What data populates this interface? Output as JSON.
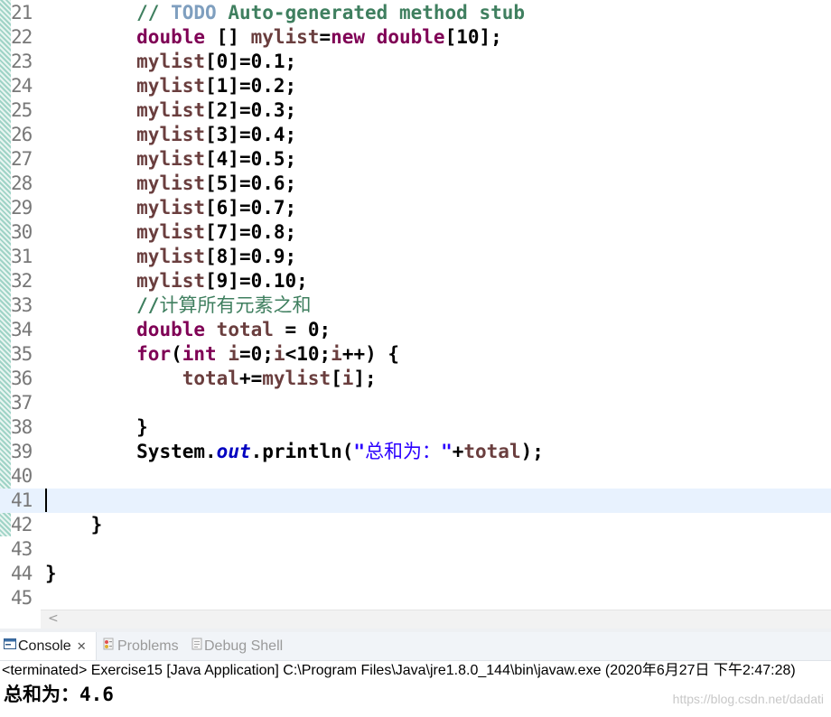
{
  "editor": {
    "line_numbers": [
      "21",
      "22",
      "23",
      "24",
      "25",
      "26",
      "27",
      "28",
      "29",
      "30",
      "31",
      "32",
      "33",
      "34",
      "35",
      "36",
      "37",
      "38",
      "39",
      "40",
      "41",
      "42",
      "43",
      "44",
      "45"
    ],
    "l21": {
      "indent": "        ",
      "cmt_slashes": "// ",
      "todo": "TODO",
      "cmt_rest": " Auto-generated method stub"
    },
    "l22": {
      "indent": "        ",
      "kw1": "double",
      "p1": " [] ",
      "var": "mylist",
      "p2": "=",
      "kw2": "new",
      "p3": " ",
      "kw3": "double",
      "p4": "[10];"
    },
    "assign": [
      {
        "var": "mylist",
        "text": "[0]=0.1;"
      },
      {
        "var": "mylist",
        "text": "[1]=0.2;"
      },
      {
        "var": "mylist",
        "text": "[2]=0.3;"
      },
      {
        "var": "mylist",
        "text": "[3]=0.4;"
      },
      {
        "var": "mylist",
        "text": "[4]=0.5;"
      },
      {
        "var": "mylist",
        "text": "[5]=0.6;"
      },
      {
        "var": "mylist",
        "text": "[6]=0.7;"
      },
      {
        "var": "mylist",
        "text": "[7]=0.8;"
      },
      {
        "var": "mylist",
        "text": "[8]=0.9;"
      },
      {
        "var": "mylist",
        "text": "[9]=0.10;"
      }
    ],
    "l33": {
      "indent": "        ",
      "slashes": "//",
      "cjk": "计算所有元素之和"
    },
    "l34": {
      "indent": "        ",
      "kw": "double",
      "p1": " ",
      "var": "total",
      "p2": " = 0;"
    },
    "l35": {
      "indent": "        ",
      "kw1": "for",
      "p1": "(",
      "kw2": "int",
      "p2": " ",
      "v1": "i",
      "p3": "=0;",
      "v2": "i",
      "p4": "<10;",
      "v3": "i",
      "p5": "++) {"
    },
    "l36": {
      "indent": "            ",
      "v1": "total",
      "p1": "+=",
      "v2": "mylist",
      "p2": "[",
      "v3": "i",
      "p3": "];"
    },
    "l38": {
      "text": "        }"
    },
    "l39": {
      "indent": "        ",
      "p1": "System.",
      "fld": "out",
      "p2": ".println(",
      "s1": "\"",
      "s_cjk": "总和为：",
      "s2": "\"",
      "p3": "+",
      "var": "total",
      "p4": ");"
    },
    "l42": {
      "text": "    }"
    },
    "l44": {
      "text": "}"
    }
  },
  "console": {
    "tabs": [
      {
        "label": "Console",
        "icon": "console-icon",
        "active": true
      },
      {
        "label": "Problems",
        "icon": "problems-icon"
      },
      {
        "label": "Debug Shell",
        "icon": "debug-shell-icon"
      }
    ],
    "close_glyph": "✕",
    "status": "<terminated> Exercise15 [Java Application] C:\\Program Files\\Java\\jre1.8.0_144\\bin\\javaw.exe (2020年6月27日 下午2:47:28)",
    "output_label": "总和为：",
    "output_value": "4.6"
  },
  "hscroll": {
    "arrow": "<"
  },
  "watermark": "https://blog.csdn.net/dadati"
}
